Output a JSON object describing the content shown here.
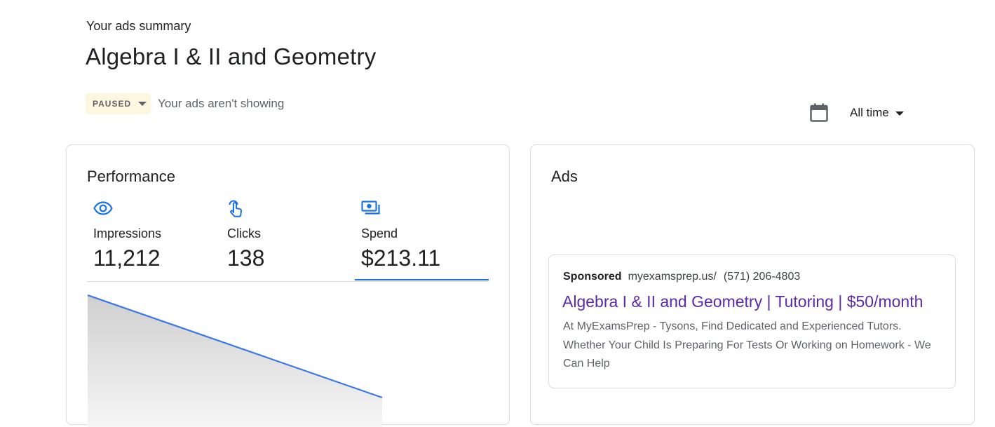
{
  "header": {
    "summary_label": "Your ads summary",
    "campaign_title": "Algebra I & II and Geometry",
    "status_badge": "PAUSED",
    "status_text": "Your ads aren't showing",
    "date_range": "All time"
  },
  "performance": {
    "title": "Performance",
    "metrics": [
      {
        "icon": "eye-icon",
        "label": "Impressions",
        "value": "11,212"
      },
      {
        "icon": "touch-icon",
        "label": "Clicks",
        "value": "138"
      },
      {
        "icon": "money-icon",
        "label": "Spend",
        "value": "$213.11"
      }
    ],
    "selected_metric": "Spend"
  },
  "ads": {
    "title": "Ads",
    "preview": {
      "sponsored": "Sponsored",
      "url": "myexamsprep.us/",
      "phone": "(571) 206-4803",
      "headline": "Algebra I & II and Geometry | Tutoring | $50/month",
      "description": "At MyExamsPrep - Tysons, Find Dedicated and Experienced Tutors. Whether Your Child Is Preparing For Tests Or Working on Homework - We Can Help"
    }
  },
  "colors": {
    "accent": "#1a73e8",
    "headline": "#5b2aa6",
    "paused_bg": "#fef7e0"
  }
}
